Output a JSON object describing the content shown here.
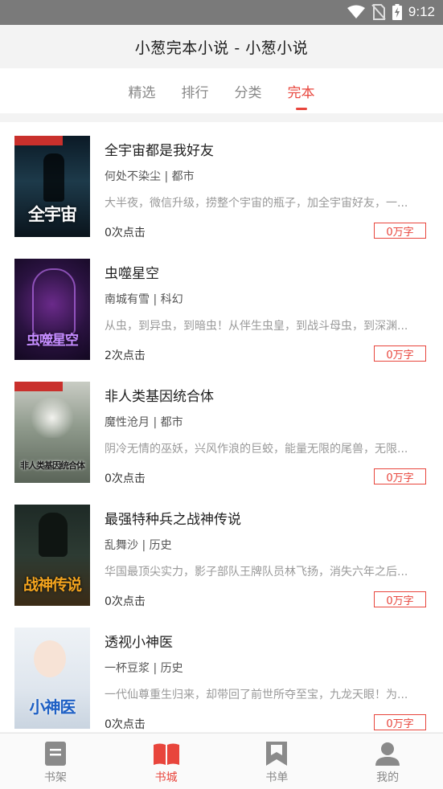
{
  "status_bar": {
    "time": "9:12"
  },
  "app": {
    "title": "小葱完本小说 - 小葱小说"
  },
  "tabs": [
    {
      "label": "精选",
      "active": false
    },
    {
      "label": "排行",
      "active": false
    },
    {
      "label": "分类",
      "active": false
    },
    {
      "label": "完本",
      "active": true
    }
  ],
  "books": [
    {
      "title": "全宇宙都是我好友",
      "meta": "何处不染尘 | 都市",
      "desc": "大半夜，微信升级，捞整个宇宙的瓶子，加全宇宙好友，一...",
      "clicks": "0次点击",
      "words": "0万字",
      "cover_text": "全宇宙"
    },
    {
      "title": "虫噬星空",
      "meta": "南城有雪 | 科幻",
      "desc": "从虫，到异虫，到暗虫！从伴生虫皇，到战斗母虫，到深渊...",
      "clicks": "2次点击",
      "words": "0万字",
      "cover_text": "虫噬星空"
    },
    {
      "title": "非人类基因统合体",
      "meta": "魔性沧月 | 都市",
      "desc": "阴冷无情的巫妖，兴风作浪的巨蛟，能量无限的尾兽，无限...",
      "clicks": "0次点击",
      "words": "0万字",
      "cover_text": "非人类基因统合体"
    },
    {
      "title": "最强特种兵之战神传说",
      "meta": "乱舞沙 | 历史",
      "desc": "华国最顶尖实力，影子部队王牌队员林飞扬，消失六年之后...",
      "clicks": "0次点击",
      "words": "0万字",
      "cover_text": "战神传说"
    },
    {
      "title": "透视小神医",
      "meta": "一杯豆浆 | 历史",
      "desc": "一代仙尊重生归来，却带回了前世所夺至宝，九龙天眼！为...",
      "clicks": "0次点击",
      "words": "0万字",
      "cover_text": "小神医"
    }
  ],
  "bottom_nav": [
    {
      "label": "书架",
      "icon": "bookshelf-icon",
      "active": false
    },
    {
      "label": "书城",
      "icon": "open-book-icon",
      "active": true
    },
    {
      "label": "书单",
      "icon": "bookmark-icon",
      "active": false
    },
    {
      "label": "我的",
      "icon": "person-icon",
      "active": false
    }
  ],
  "colors": {
    "accent": "#e8453c",
    "status_bar": "#7a7a7a",
    "inactive": "#888888"
  }
}
